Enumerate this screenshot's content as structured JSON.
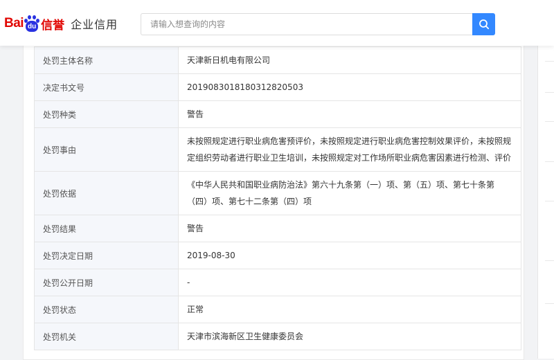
{
  "brand": {
    "logo_bai": "Bai",
    "logo_du": "du",
    "logo_xinyu": "信誉",
    "product": "企业信用"
  },
  "search": {
    "placeholder": "请输入想查询的内容"
  },
  "colors": {
    "accent": "#3388ff",
    "brand_red": "#e10602",
    "brand_blue": "#2932e1",
    "label_bg": "#f5f7fb"
  },
  "details": [
    {
      "label": "处罚主体名称",
      "value": "天津新日机电有限公司"
    },
    {
      "label": "决定书文号",
      "value": "20190830181803128205​03"
    },
    {
      "label": "处罚种类",
      "value": "警告"
    },
    {
      "label": "处罚事由",
      "value": "未按照规定进行职业病危害预评价，未按照规定进行职业病危害控制效果评价，未按照规定组织劳动者进行职业卫生培训，未按照规定对工作场所职业病危害因素进行检测、评价"
    },
    {
      "label": "处罚依据",
      "value": "《中华人民共和国职业病防治法》第六十九条第（一）项、第（五）项、第七十条第（四）项、第七十二条第（四）项"
    },
    {
      "label": "处罚结果",
      "value": "警告"
    },
    {
      "label": "处罚决定日期",
      "value": "2019-08-30"
    },
    {
      "label": "处罚公开日期",
      "value": "-"
    },
    {
      "label": "处罚状态",
      "value": "正常"
    },
    {
      "label": "处罚机关",
      "value": "天津市滨海新区卫生健康委员会"
    }
  ]
}
